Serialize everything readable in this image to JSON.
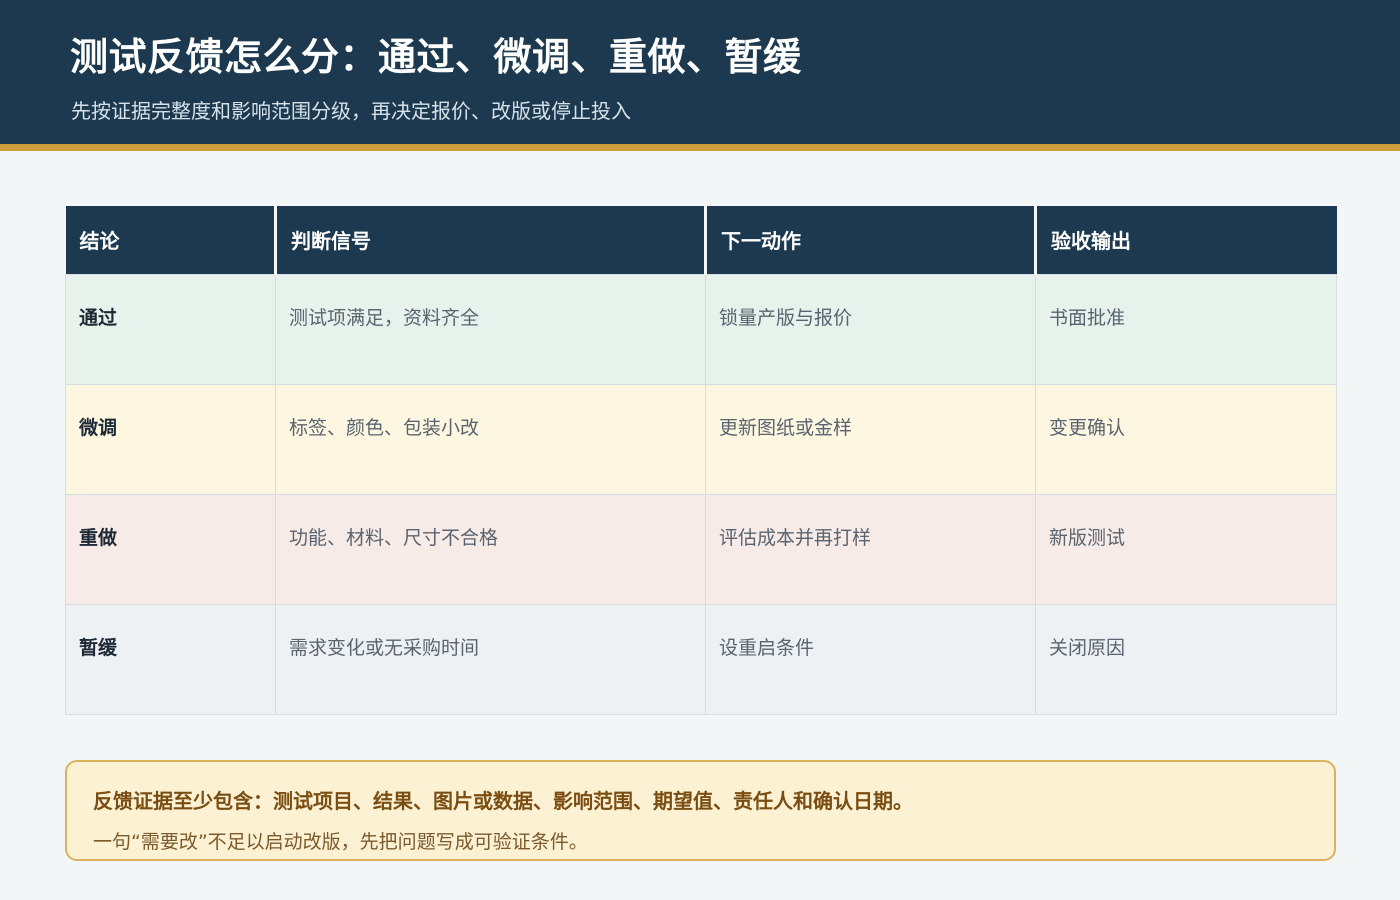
{
  "header": {
    "title": "测试反馈怎么分：通过、微调、重做、暂缓",
    "subtitle": "先按证据完整度和影响范围分级，再决定报价、改版或停止投入"
  },
  "table": {
    "columns": [
      "结论",
      "判断信号",
      "下一动作",
      "验收输出"
    ],
    "rows": [
      {
        "status": "通过",
        "signal": "测试项满足，资料齐全",
        "action": "锁量产版与报价",
        "output": "书面批准"
      },
      {
        "status": "微调",
        "signal": "标签、颜色、包装小改",
        "action": "更新图纸或金样",
        "output": "变更确认"
      },
      {
        "status": "重做",
        "signal": "功能、材料、尺寸不合格",
        "action": "评估成本并再打样",
        "output": "新版测试"
      },
      {
        "status": "暂缓",
        "signal": "需求变化或无采购时间",
        "action": "设重启条件",
        "output": "关闭原因"
      }
    ]
  },
  "note": {
    "main": "反馈证据至少包含：测试项目、结果、图片或数据、影响范围、期望值、责任人和确认日期。",
    "sub": "一句“需要改”不足以启动改版，先把问题写成可验证条件。"
  },
  "colors": {
    "header_bg": "#1c394f",
    "accent_stripe": "#cf9d3b",
    "row_pass": "#e7f2ec",
    "row_tweak": "#fdf7e1",
    "row_redo": "#f7ebe7",
    "row_hold": "#edf1f4",
    "note_bg": "#fdf1d3"
  }
}
